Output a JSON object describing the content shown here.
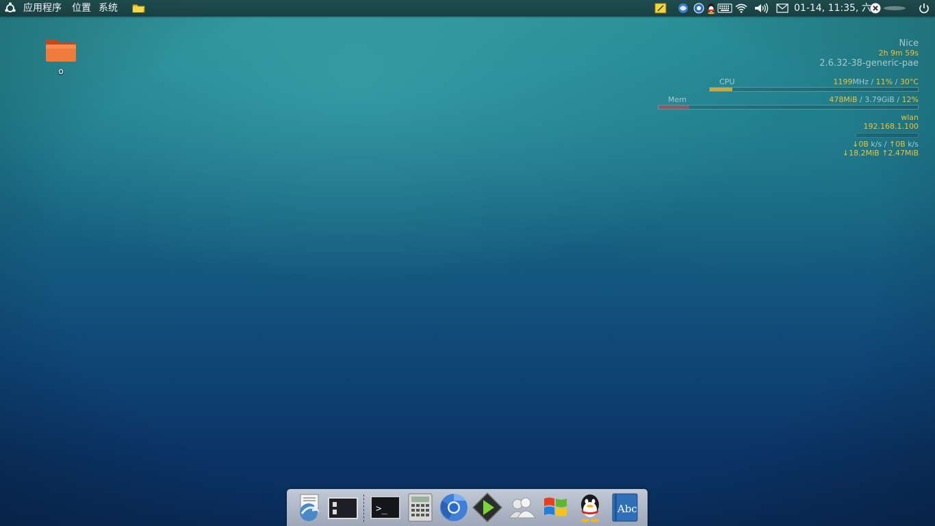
{
  "top_panel": {
    "menus": [
      "应用程序",
      "位置",
      "系统"
    ],
    "clock": "01-14, 11:35, 六",
    "icons": [
      "ubuntu-logo-icon",
      "folder-launcher-icon",
      "notes-icon",
      "network-app-icon",
      "chat-icon",
      "qq-tray-icon",
      "keyboard-icon",
      "wifi-icon",
      "volume-icon",
      "mail-icon",
      "user-icon",
      "power-icon"
    ]
  },
  "desktop": {
    "folder_label": "o"
  },
  "conky": {
    "host": "Nice",
    "uptime": "2h 9m 59s",
    "kernel": "2.6.32-38-generic-pae",
    "cpu": {
      "label": "CPU",
      "freq": "1199",
      "freq_unit": "MHz",
      "usage": "11%",
      "temp": "30°C",
      "sep": " / "
    },
    "mem": {
      "label": "Mem",
      "used": "478MiB",
      "total": "3.79GiB",
      "percent": "12%",
      "sep": " / "
    },
    "net": {
      "iface": "wlan",
      "ip": "192.168.1.100",
      "down_rate": "↓0B",
      "up_rate": "↑0B",
      "rate_unit": "k/s",
      "sep": " / ",
      "down_total": "↓18.2MiB",
      "up_total": "↑2.47MiB"
    },
    "bars": {
      "cpu_fraction": 0.11,
      "mem_fraction": 0.12,
      "net_fraction": 0.0
    },
    "colors": {
      "gold": "#f2c230",
      "gray": "#a7c8cb",
      "mem_bar": "#8b5a66"
    }
  },
  "dock": {
    "items": [
      "file-manager-icon",
      "show-desktop-icon",
      "terminal-icon",
      "calculator-icon",
      "chromium-icon",
      "play-media-icon",
      "contacts-icon",
      "windows-icon",
      "qq-icon",
      "dictionary-icon"
    ],
    "dictionary_text": "Abc",
    "terminal_prompt": ">_"
  }
}
